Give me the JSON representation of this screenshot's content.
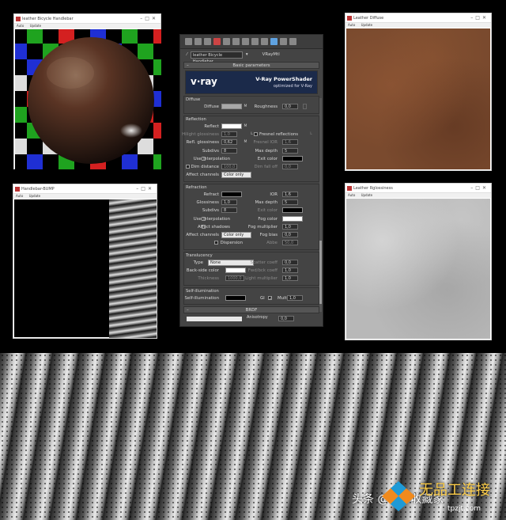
{
  "windows": {
    "preview": {
      "title": "leather Bicycle Handlebar",
      "menu": [
        "Auto",
        "Update"
      ]
    },
    "bump": {
      "title": "Handlebar-BUMP",
      "menu": [
        "Auto",
        "Update"
      ]
    },
    "diffuse": {
      "title": "Leather Diffuse",
      "menu": [
        "Auto",
        "Update"
      ]
    },
    "glossiness": {
      "title": "Leather Rglossiness",
      "menu": [
        "Auto",
        "Update"
      ]
    }
  },
  "editor": {
    "material_name": "leather Bicycle Handlebar",
    "material_type": "VRayMtl",
    "rollout_basic": "Basic parameters",
    "logo": {
      "brand": "v·ray",
      "product": "V-Ray PowerShader",
      "tagline": "optimized for V-Ray"
    },
    "diffuse": {
      "title": "Diffuse",
      "diffuse_label": "Diffuse",
      "m": "M",
      "roughness_label": "Roughness",
      "roughness": "0,0"
    },
    "reflection": {
      "title": "Reflection",
      "reflect_label": "Reflect",
      "hilight_label": "Hilight glossiness",
      "hilight": "1,0",
      "l_btn": "L",
      "refl_gloss_label": "Refl. glossiness",
      "refl_gloss": "0,62",
      "subdivs_label": "Subdivs",
      "subdivs": "8",
      "interp_label": "Use interpolation",
      "dim_label": "Dim distance",
      "dim": "100,0",
      "affect_label": "Affect channels",
      "affect": "Color only",
      "fresnel_label": "Fresnel reflections",
      "fresnel_ior_label": "Fresnel IOR",
      "fresnel_ior": "1,6",
      "max_depth_label": "Max depth",
      "max_depth": "5",
      "exit_label": "Exit color",
      "dimfall_label": "Dim fall off",
      "dimfall": "0,0"
    },
    "refraction": {
      "title": "Refraction",
      "refract_label": "Refract",
      "gloss_label": "Glossiness",
      "gloss": "1,0",
      "subdivs_label": "Subdivs",
      "subdivs": "8",
      "interp_label": "Use interpolation",
      "shadows_label": "Affect shadows",
      "affect_label": "Affect channels",
      "affect": "Color only",
      "dispersion_label": "Dispersion",
      "ior_label": "IOR",
      "ior": "1,6",
      "max_depth_label": "Max depth",
      "max_depth": "5",
      "exit_label": "Exit color",
      "fog_color_label": "Fog color",
      "fog_mult_label": "Fog multiplier",
      "fog_mult": "1,0",
      "fog_bias_label": "Fog bias",
      "fog_bias": "0,0",
      "abbe_label": "Abbe",
      "abbe": "50,0"
    },
    "translucency": {
      "title": "Translucency",
      "type_label": "Type",
      "type": "None",
      "backside_label": "Back-side color",
      "thickness_label": "Thickness",
      "thickness": "1000,0",
      "scatter_label": "Scatter coeff",
      "scatter": "0,0",
      "fwd_label": "Fwd/bck coeff",
      "fwd": "1,0",
      "light_label": "Light multiplier",
      "light": "1,0"
    },
    "selfillum": {
      "title": "Self-illumination",
      "label": "Self-illumination",
      "gi_label": "GI",
      "mult_label": "Mult",
      "mult": "1,0"
    },
    "rollout_brdf": "BRDF",
    "brdf_partial": {
      "label": "Anisotropy",
      "value": "0,0"
    }
  },
  "watermark": {
    "left": "头条 @",
    "right": "设计收藏家",
    "brand": "无品工连接",
    "url": "tpzjt.com"
  },
  "colors": {
    "editor_bg": "#444444",
    "leather_brown": "#7a4a2e",
    "vray_blue": "#1b2a4a"
  }
}
